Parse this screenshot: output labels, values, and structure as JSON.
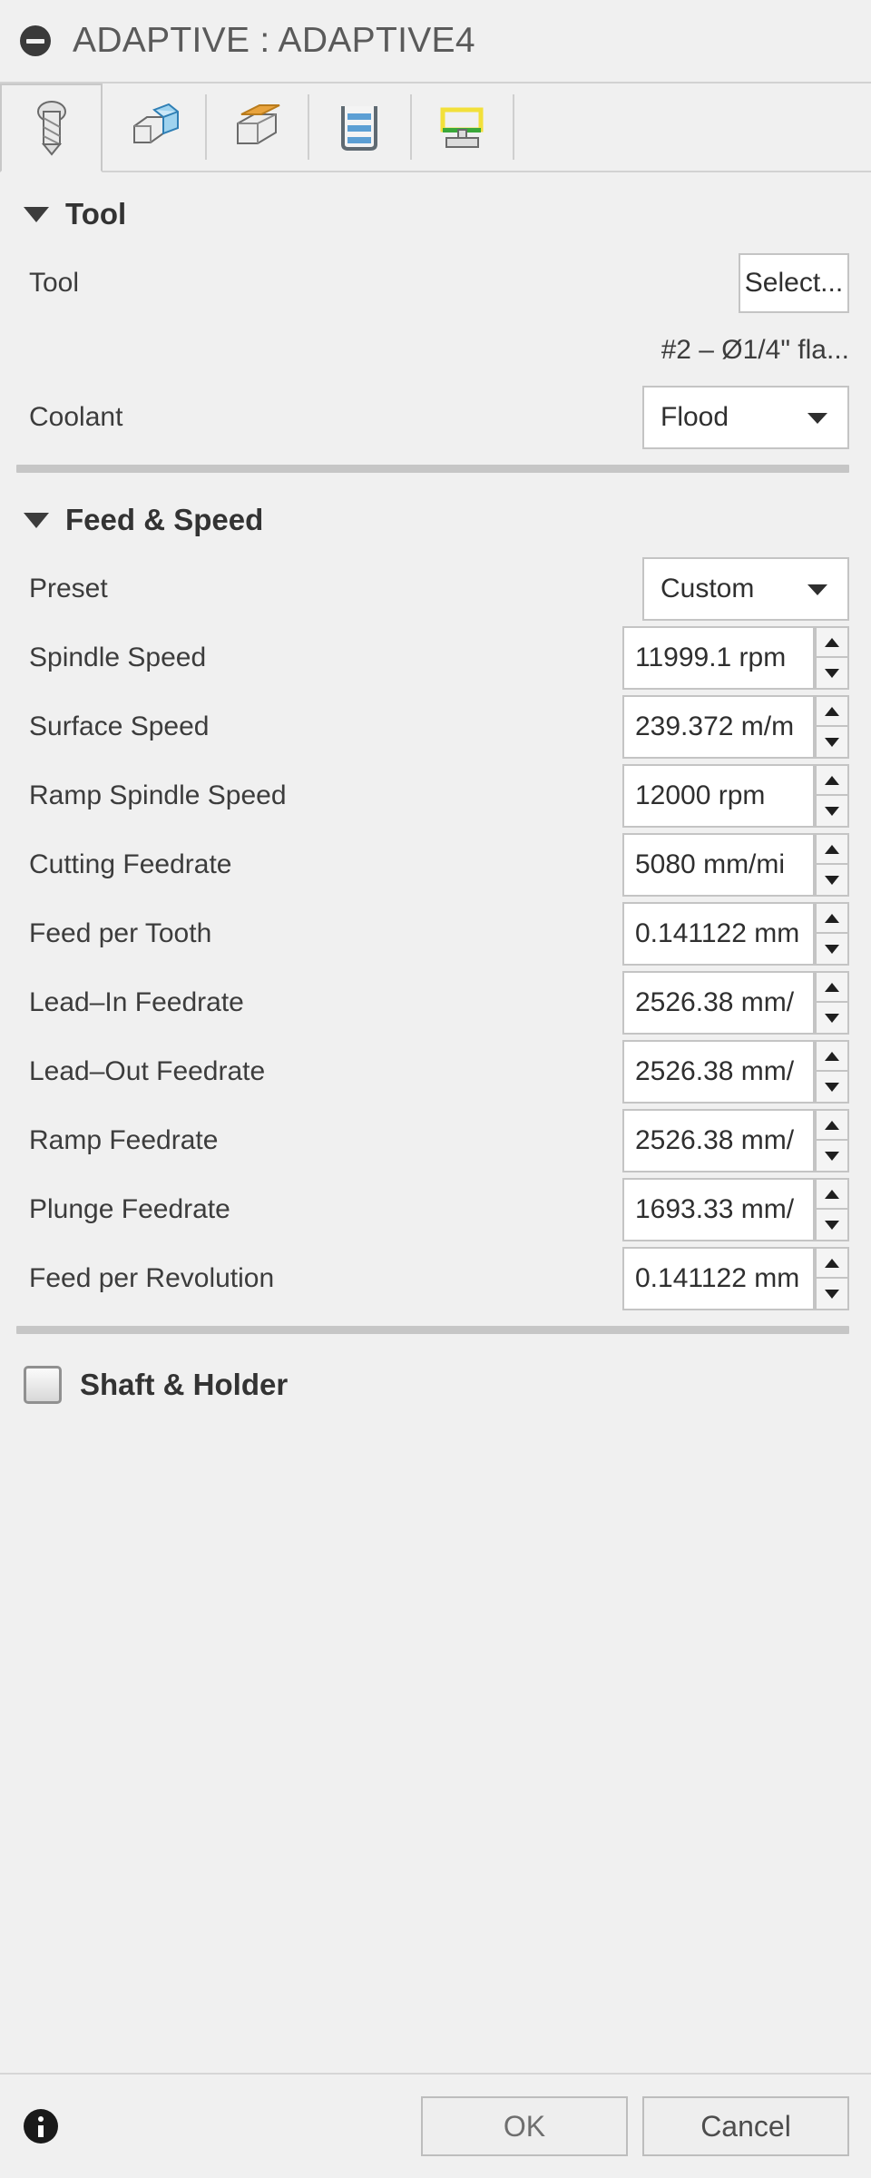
{
  "window": {
    "title": "ADAPTIVE : ADAPTIVE4",
    "title_icon": "minus-circle-icon"
  },
  "tabs": [
    {
      "id": "tool",
      "icon": "end-mill-tool-icon",
      "selected": true
    },
    {
      "id": "geometry",
      "icon": "geometry-solid-icon",
      "selected": false
    },
    {
      "id": "heights",
      "icon": "heights-cube-icon",
      "selected": false
    },
    {
      "id": "passes",
      "icon": "passes-stepover-icon",
      "selected": false
    },
    {
      "id": "linking",
      "icon": "linking-ramp-icon",
      "selected": false
    }
  ],
  "tool_group": {
    "title": "Tool",
    "expanded": true,
    "tool_row_label": "Tool",
    "select_button_label": "Select...",
    "tool_description": "#2 – Ø1/4\" fla...",
    "coolant_label": "Coolant",
    "coolant_value": "Flood"
  },
  "feed_speed_group": {
    "title": "Feed & Speed",
    "expanded": true,
    "preset_label": "Preset",
    "preset_value": "Custom",
    "fields": [
      {
        "label": "Spindle Speed",
        "value": "11999.1 rpm"
      },
      {
        "label": "Surface Speed",
        "value": "239.372 m/m"
      },
      {
        "label": "Ramp Spindle Speed",
        "value": "12000 rpm"
      },
      {
        "label": "Cutting Feedrate",
        "value": "5080 mm/mi"
      },
      {
        "label": "Feed per Tooth",
        "value": "0.141122 mm"
      },
      {
        "label": "Lead–In Feedrate",
        "value": "2526.38 mm/"
      },
      {
        "label": "Lead–Out Feedrate",
        "value": "2526.38 mm/"
      },
      {
        "label": "Ramp Feedrate",
        "value": "2526.38 mm/"
      },
      {
        "label": "Plunge Feedrate",
        "value": "1693.33 mm/"
      },
      {
        "label": "Feed per Revolution",
        "value": "0.141122 mm"
      }
    ]
  },
  "shaft_holder": {
    "label": "Shaft & Holder",
    "checked": false
  },
  "footer": {
    "info_icon": "info-icon",
    "ok_label": "OK",
    "cancel_label": "Cancel"
  },
  "colors": {
    "background": "#f0f0f0",
    "field_background": "#ffffff",
    "border": "#c4c4c4",
    "text": "#3c3c3c",
    "title_text": "#5a5a5a",
    "separator": "#c6c6c6",
    "accent_blue": "#6fb3e0",
    "accent_orange": "#e8a33d",
    "accent_yellow": "#f2e03a",
    "accent_green": "#3aa83a"
  }
}
